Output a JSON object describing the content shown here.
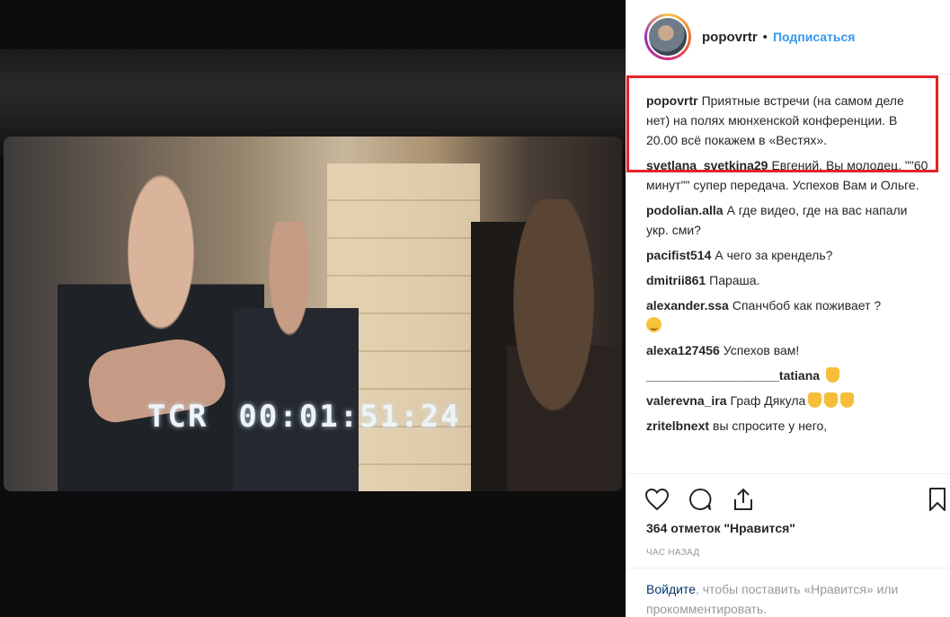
{
  "post": {
    "username": "popovrtr",
    "separator": "•",
    "follow_label": "Подписаться",
    "timecode_label": "TCR",
    "timecode_value": "00:01:51:24"
  },
  "caption": {
    "user": "popovrtr",
    "text": "Приятные встречи (на самом деле нет) на полях мюнхенской конференции. В 20.00 всё покажем в «Вестях»."
  },
  "comments": [
    {
      "user": "svetlana_svetkina29",
      "text": "Евгений, Вы молодец. \"\"60 минут\"\" супер передача. Успехов Вам и Ольге.",
      "emoji": ""
    },
    {
      "user": "podolian.alla",
      "text": "А где видео, где на вас напали укр. сми?",
      "emoji": ""
    },
    {
      "user": "pacifist514",
      "text": "А чего за крендель?",
      "emoji": ""
    },
    {
      "user": "dmitrii861",
      "text": "Параша.",
      "emoji": ""
    },
    {
      "user": "alexander.ssa",
      "text": "Спанчбоб как поживает ?",
      "emoji": "smiling-face-icon"
    },
    {
      "user": "alexa127456",
      "text": "Успехов вам!",
      "emoji": ""
    },
    {
      "user": "___________________tatiana",
      "text": "",
      "emoji": "thumbs-up-icon"
    },
    {
      "user": "valerevna_ira",
      "text": "Граф Дякула",
      "emoji": "clapping-hands-icon"
    },
    {
      "user": "zritelbnext",
      "text": "вы спросите у него,",
      "emoji": ""
    }
  ],
  "actions": {
    "icons": [
      "heart-icon",
      "comment-icon",
      "share-icon",
      "bookmark-icon"
    ]
  },
  "likes_text": "364 отметок \"Нравится\"",
  "time_text": "ЧАС НАЗАД",
  "login_prompt": {
    "link": "Войдите",
    "rest": ", чтобы поставить «Нравится» или прокомментировать."
  },
  "colors": {
    "follow": "#3897f0",
    "highlight_box": "#e4222b",
    "login_link": "#003569"
  }
}
